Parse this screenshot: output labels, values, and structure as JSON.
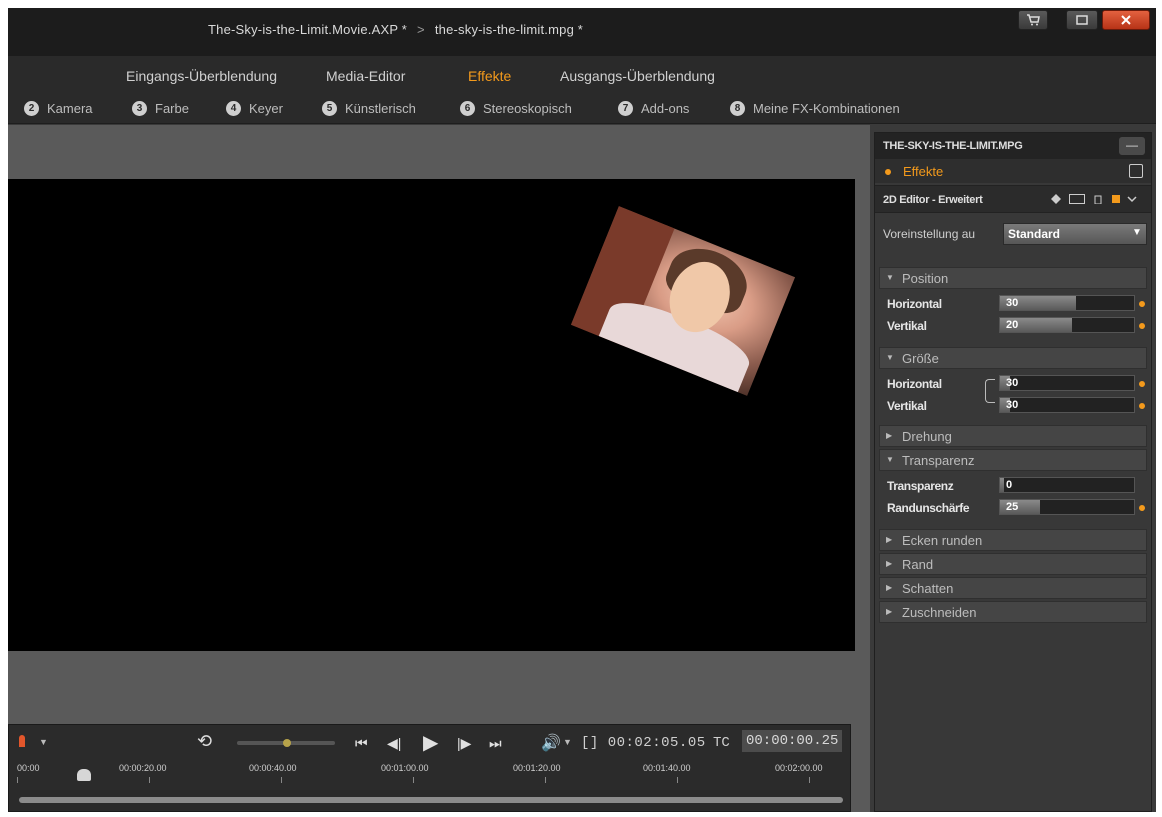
{
  "window": {
    "project_title": "The-Sky-is-the-Limit.Movie.AXP *",
    "separator": ">",
    "clip_title": "the-sky-is-the-limit.mpg *"
  },
  "tabs": [
    {
      "label": "Eingangs-Überblendung"
    },
    {
      "label": "Media-Editor"
    },
    {
      "label": "Effekte"
    },
    {
      "label": "Ausgangs-Überblendung"
    }
  ],
  "categories": [
    {
      "num": "2",
      "label": "Kamera"
    },
    {
      "num": "3",
      "label": "Farbe"
    },
    {
      "num": "4",
      "label": "Keyer"
    },
    {
      "num": "5",
      "label": "Künstlerisch"
    },
    {
      "num": "6",
      "label": "Stereoskopisch"
    },
    {
      "num": "7",
      "label": "Add-ons"
    },
    {
      "num": "8",
      "label": "Meine FX-Kombinationen"
    }
  ],
  "transport": {
    "duration": "[] 00:02:05.05",
    "tc_label": "TC",
    "tc_value": "00:00:00.25",
    "ruler": [
      "00:00",
      "00:00:20.00",
      "00:00:40.00",
      "00:01:00.00",
      "00:01:20.00",
      "00:01:40.00",
      "00:02:00.00"
    ]
  },
  "panel": {
    "clip_name": "THE-SKY-IS-THE-LIMIT.MPG",
    "minimize": "—",
    "effects_label": "Effekte",
    "editor_title": "2D Editor - Erweitert",
    "preset_label": "Voreinstellung au",
    "preset_value": "Standard",
    "sections": {
      "position": {
        "title": "Position",
        "horizontal_label": "Horizontal",
        "horizontal_value": "30",
        "vertical_label": "Vertikal",
        "vertical_value": "20"
      },
      "size": {
        "title": "Größe",
        "horizontal_label": "Horizontal",
        "horizontal_value": "30",
        "vertical_label": "Vertikal",
        "vertical_value": "30"
      },
      "rotation": {
        "title": "Drehung"
      },
      "transparency": {
        "title": "Transparenz",
        "transparency_label": "Transparenz",
        "transparency_value": "0",
        "edge_label": "Randunschärfe",
        "edge_value": "25"
      },
      "corners": {
        "title": "Ecken runden"
      },
      "border": {
        "title": "Rand"
      },
      "shadow": {
        "title": "Schatten"
      },
      "crop": {
        "title": "Zuschneiden"
      }
    }
  },
  "colors": {
    "accent": "#f39a1c",
    "close": "#c93f22"
  }
}
